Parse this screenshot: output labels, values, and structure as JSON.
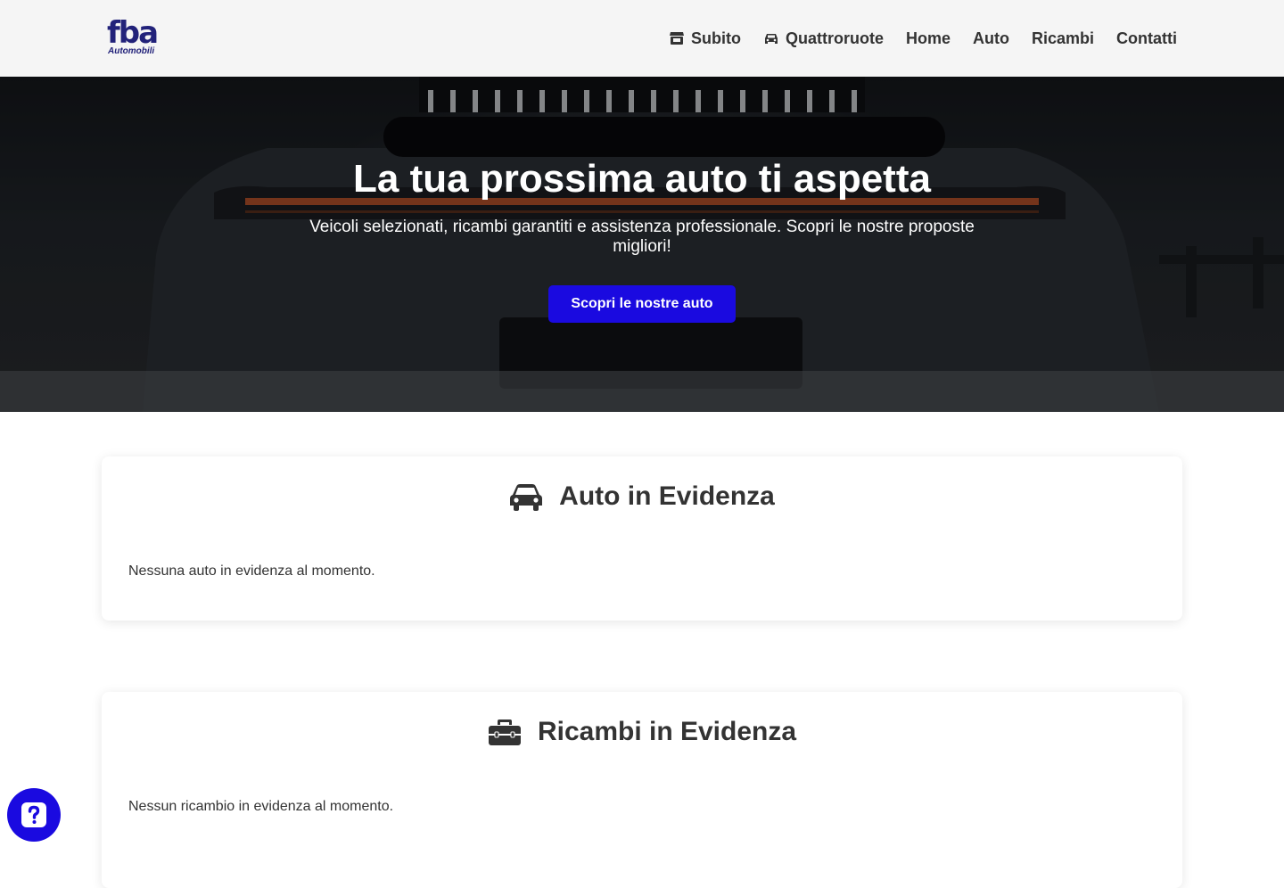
{
  "brand": {
    "logo_text": "fba",
    "logo_subtext": "Automobili",
    "color": "#22227a"
  },
  "nav": {
    "items": [
      {
        "label": "Subito",
        "icon": "shop-icon"
      },
      {
        "label": "Quattroruote",
        "icon": "car-icon"
      },
      {
        "label": "Home"
      },
      {
        "label": "Auto"
      },
      {
        "label": "Ricambi"
      },
      {
        "label": "Contatti"
      }
    ]
  },
  "hero": {
    "title": "La tua prossima auto ti aspetta",
    "subtitle": "Veicoli selezionati, ricambi garantiti e assistenza professionale. Scopri le nostre proposte migliori!",
    "cta_label": "Scopri le nostre auto",
    "cta_color": "#1a0ae0"
  },
  "featured_cars": {
    "title": "Auto in Evidenza",
    "icon": "car-icon",
    "empty_text": "Nessuna auto in evidenza al momento."
  },
  "featured_parts": {
    "title": "Ricambi in Evidenza",
    "icon": "toolbox-icon",
    "empty_text": "Nessun ricambio in evidenza al momento."
  },
  "help_widget": {
    "icon": "question-icon"
  }
}
